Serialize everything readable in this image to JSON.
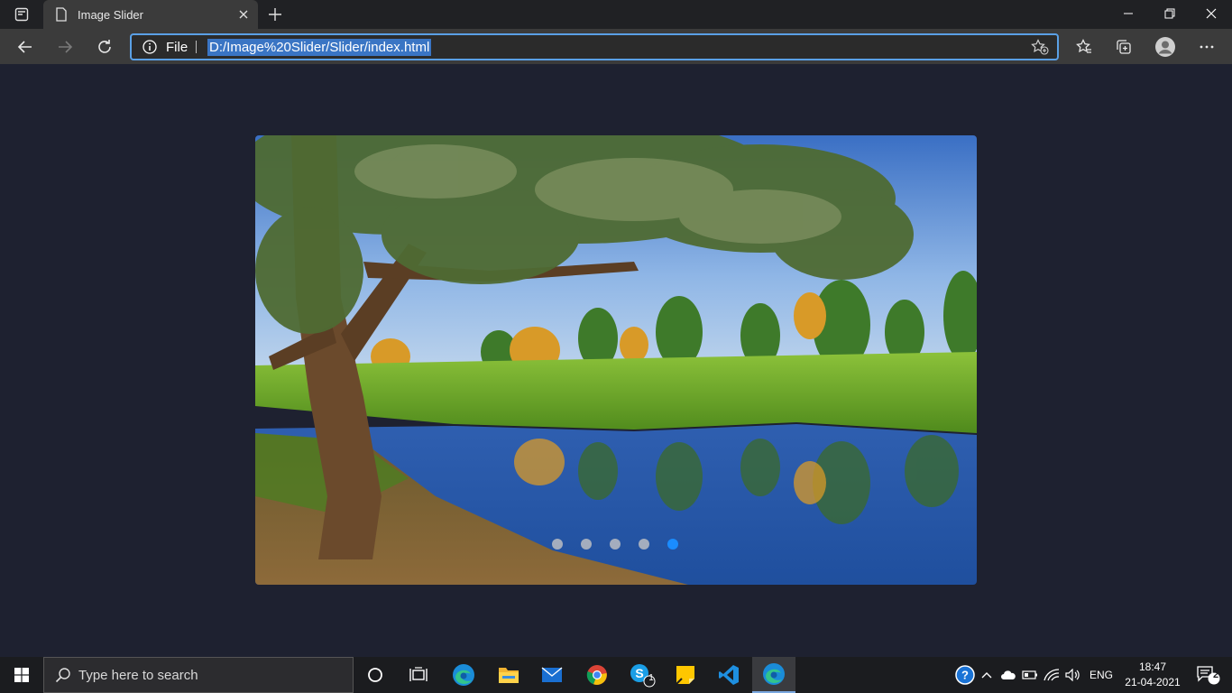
{
  "browser": {
    "tab_title": "Image Slider",
    "site_info_label": "File",
    "url": "D:/Image%20Slider/Slider/index.html"
  },
  "slider": {
    "slide_count": 5,
    "active_index": 4,
    "active_dot_color": "#1a8cff",
    "dot_color": "#c4c4c4"
  },
  "taskbar": {
    "search_placeholder": "Type here to search",
    "apps": [
      "cortana-icon",
      "task-view-icon",
      "edge-icon",
      "file-explorer-icon",
      "mail-icon",
      "chrome-icon",
      "skype-icon",
      "sticky-notes-icon",
      "vscode-icon",
      "edge-active-icon"
    ],
    "skype_badge": "1",
    "language": "ENG",
    "time": "18:47",
    "date": "21-04-2021",
    "notification_count": "2"
  }
}
